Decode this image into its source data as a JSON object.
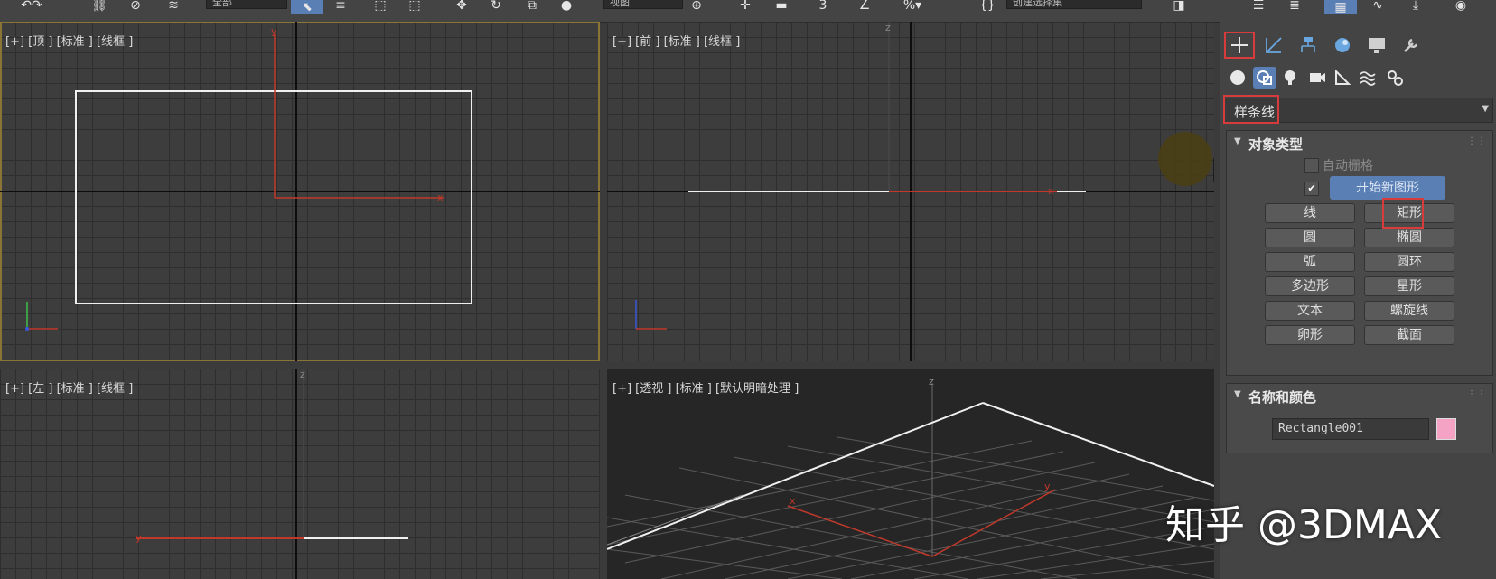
{
  "toolbar": {
    "selection_filter_value": "全部",
    "view_dropdown_value": "视图",
    "named_selection_value": "创建选择集"
  },
  "viewports": {
    "top": {
      "label": "[+] [顶 ] [标准 ] [线框 ]"
    },
    "front": {
      "label": "[+] [前 ] [标准 ] [线框 ]"
    },
    "left": {
      "label": "[+] [左 ] [标准 ] [线框 ]"
    },
    "persp": {
      "label": "[+] [透视 ] [标准 ] [默认明暗处理 ]"
    },
    "axis_letters": {
      "x": "x",
      "y": "y",
      "z": "z"
    }
  },
  "command_panel": {
    "tabs": [
      "create-icon",
      "modify-icon",
      "hierarchy-icon",
      "motion-icon",
      "display-icon",
      "utilities-icon"
    ],
    "categories": [
      "geometry-icon",
      "shapes-icon",
      "lights-icon",
      "cameras-icon",
      "helpers-icon",
      "spacewarps-icon",
      "systems-icon"
    ],
    "category_dropdown": "样条线",
    "object_type": {
      "title": "对象类型",
      "autogrid_label": "自动栅格",
      "start_new_shape_label": "开始新图形",
      "start_new_shape_checked": true,
      "buttons": [
        [
          "线",
          "矩形"
        ],
        [
          "圆",
          "椭圆"
        ],
        [
          "弧",
          "圆环"
        ],
        [
          "多边形",
          "星形"
        ],
        [
          "文本",
          "螺旋线"
        ],
        [
          "卵形",
          "截面"
        ]
      ]
    },
    "name_color": {
      "title": "名称和颜色",
      "object_name": "Rectangle001",
      "object_color": "#f4a3c4"
    }
  },
  "watermark": "知乎 @3DMAX",
  "colors": {
    "highlight": "#d83b3b",
    "active_viewport_border": "#8a7436",
    "axis_red": "#c0392b",
    "axis_blue": "#3a57d6",
    "axis_green": "#3fbf4a",
    "cursor_halo": "#4a3e12"
  }
}
